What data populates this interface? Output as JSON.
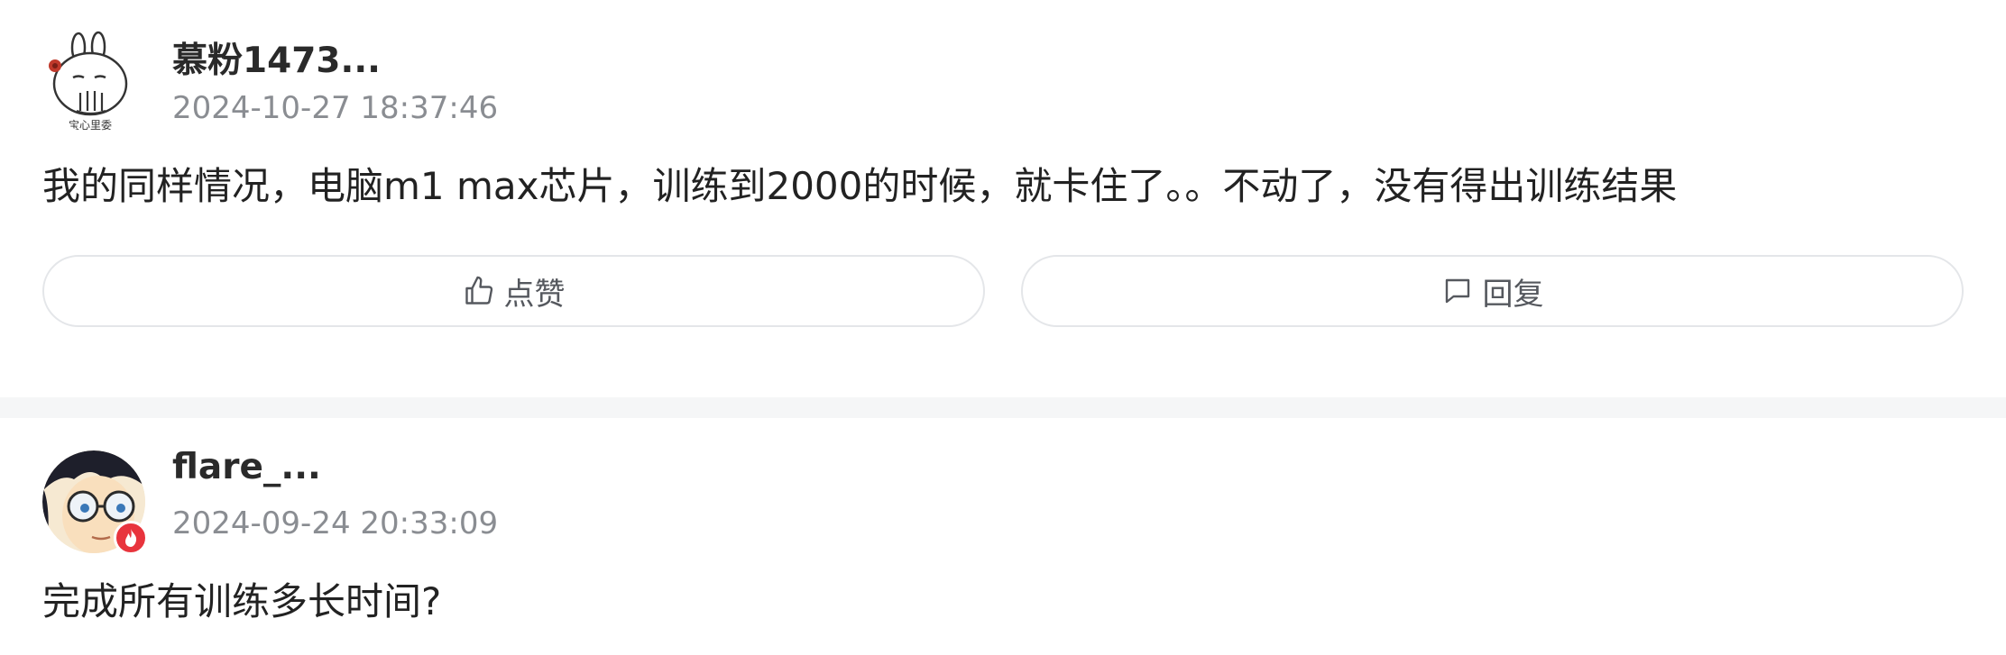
{
  "comments": [
    {
      "username": "慕粉1473...",
      "timestamp": "2024-10-27 18:37:46",
      "content": "我的同样情况，电脑m1 max芯片，训练到2000的时候，就卡住了。。不动了，没有得出训练结果",
      "avatar_caption": "宝心里委",
      "avatar_icon": "rabbit-avatar",
      "actions": {
        "like_label": "点赞",
        "like_icon": "thumbs-up-icon",
        "reply_label": "回复",
        "reply_icon": "comment-icon"
      }
    },
    {
      "username": "flare_...",
      "timestamp": "2024-09-24 20:33:09",
      "content": "完成所有训练多长时间?",
      "avatar_icon": "anime-boy-avatar",
      "badge_icon": "fire-badge-icon"
    }
  ],
  "colors": {
    "divider": "#f5f6f7",
    "badge": "#e8343d",
    "timestamp": "#8a8d92",
    "button_border": "#e4e6e9"
  }
}
